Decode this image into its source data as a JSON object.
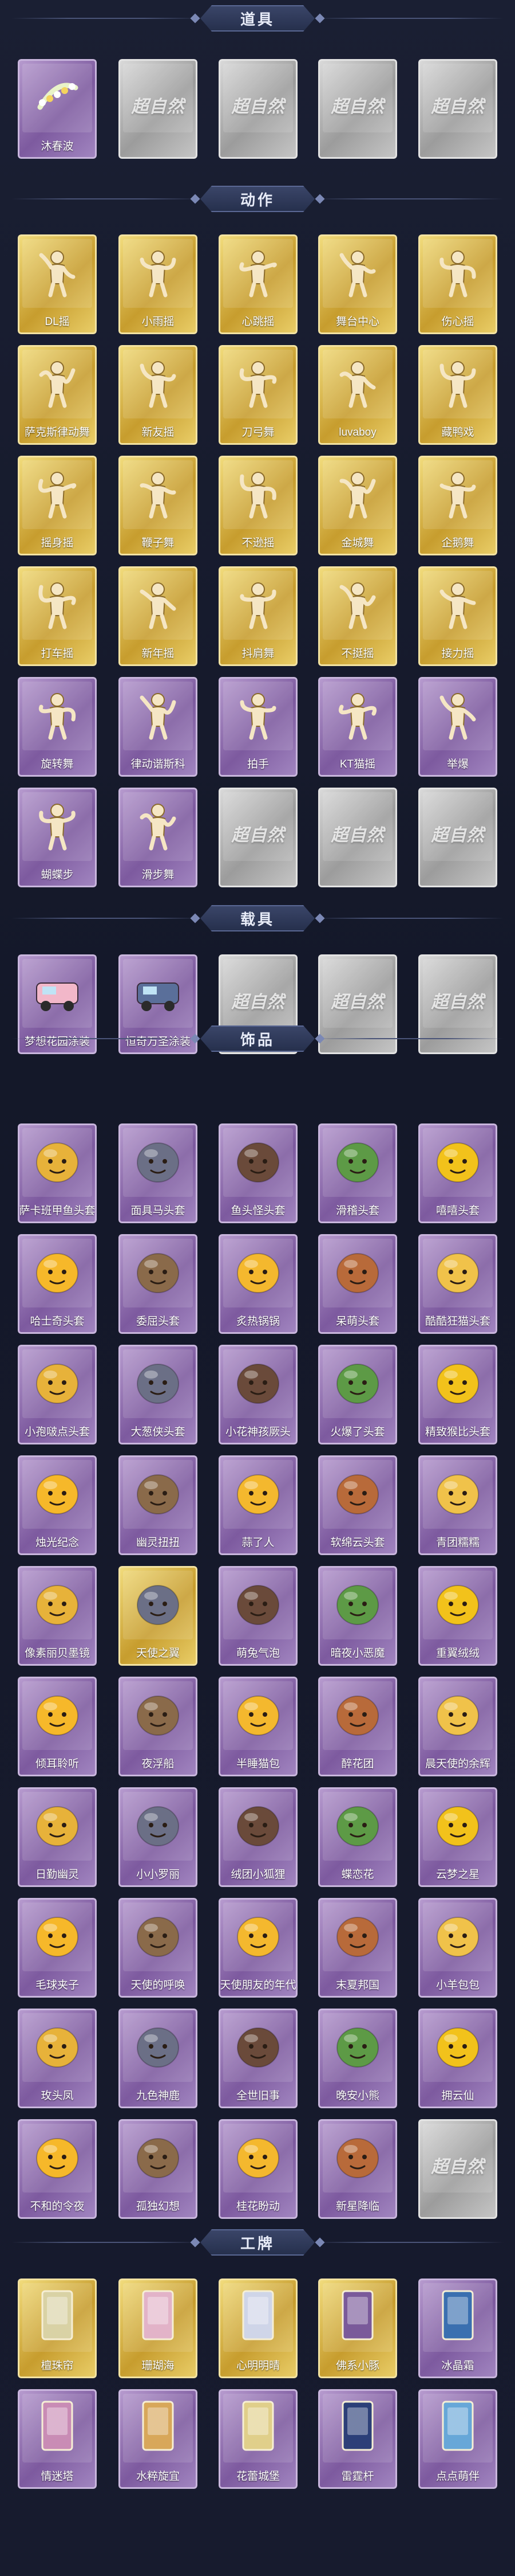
{
  "colors": {
    "background": "#161a2b",
    "gold": "#d4ab3a",
    "purple": "#8f6bb1",
    "locked": "#b3b3b3"
  },
  "locked_logo": "超自然",
  "sections": [
    {
      "title": "道具",
      "icon": "prop",
      "items": [
        {
          "name": "沐春波",
          "rarity": "purple"
        },
        {
          "name": "",
          "rarity": "locked"
        },
        {
          "name": "",
          "rarity": "locked"
        },
        {
          "name": "",
          "rarity": "locked"
        },
        {
          "name": "",
          "rarity": "locked"
        }
      ]
    },
    {
      "title": "动作",
      "icon": "pose",
      "items": [
        {
          "name": "DL摇",
          "rarity": "gold"
        },
        {
          "name": "小雨摇",
          "rarity": "gold"
        },
        {
          "name": "心跳摇",
          "rarity": "gold"
        },
        {
          "name": "舞台中心",
          "rarity": "gold"
        },
        {
          "name": "伤心摇",
          "rarity": "gold"
        },
        {
          "name": "萨克斯律动舞",
          "rarity": "gold"
        },
        {
          "name": "新友摇",
          "rarity": "gold"
        },
        {
          "name": "刀弓舞",
          "rarity": "gold"
        },
        {
          "name": "luvaboy",
          "rarity": "gold"
        },
        {
          "name": "藏鸭戏",
          "rarity": "gold"
        },
        {
          "name": "摇身摇",
          "rarity": "gold"
        },
        {
          "name": "鞭子舞",
          "rarity": "gold"
        },
        {
          "name": "不逊摇",
          "rarity": "gold"
        },
        {
          "name": "金城舞",
          "rarity": "gold"
        },
        {
          "name": "企鹅舞",
          "rarity": "gold"
        },
        {
          "name": "打车摇",
          "rarity": "gold"
        },
        {
          "name": "新年摇",
          "rarity": "gold"
        },
        {
          "name": "抖肩舞",
          "rarity": "gold"
        },
        {
          "name": "不挺摇",
          "rarity": "gold"
        },
        {
          "name": "接力摇",
          "rarity": "gold"
        },
        {
          "name": "旋转舞",
          "rarity": "purple"
        },
        {
          "name": "律动谐斯科",
          "rarity": "purple"
        },
        {
          "name": "拍手",
          "rarity": "purple"
        },
        {
          "name": "KT猫摇",
          "rarity": "purple"
        },
        {
          "name": "举爆",
          "rarity": "purple"
        },
        {
          "name": "蝴蝶步",
          "rarity": "purple"
        },
        {
          "name": "滑步舞",
          "rarity": "purple"
        },
        {
          "name": "",
          "rarity": "locked"
        },
        {
          "name": "",
          "rarity": "locked"
        },
        {
          "name": "",
          "rarity": "locked"
        }
      ]
    },
    {
      "title": "载具",
      "icon": "vehicle",
      "items": [
        {
          "name": "梦想花园涂装",
          "rarity": "purple"
        },
        {
          "name": "恒奇万圣涂装",
          "rarity": "purple"
        },
        {
          "name": "",
          "rarity": "locked"
        },
        {
          "name": "",
          "rarity": "locked"
        },
        {
          "name": "",
          "rarity": "locked"
        }
      ]
    },
    {
      "title": "饰品",
      "icon": "head",
      "items": [
        {
          "name": "萨卡班甲鱼头套",
          "rarity": "purple"
        },
        {
          "name": "面具马头套",
          "rarity": "purple"
        },
        {
          "name": "鱼头怪头套",
          "rarity": "purple"
        },
        {
          "name": "滑稽头套",
          "rarity": "purple"
        },
        {
          "name": "嘻嘻头套",
          "rarity": "purple"
        },
        {
          "name": "哈士奇头套",
          "rarity": "purple"
        },
        {
          "name": "委屈头套",
          "rarity": "purple"
        },
        {
          "name": "炙热锅锅",
          "rarity": "purple"
        },
        {
          "name": "呆萌头套",
          "rarity": "purple"
        },
        {
          "name": "酷酷狂猫头套",
          "rarity": "purple"
        },
        {
          "name": "小孢啵点头套",
          "rarity": "purple"
        },
        {
          "name": "大葱侠头套",
          "rarity": "purple"
        },
        {
          "name": "小花神孩厥头",
          "rarity": "purple"
        },
        {
          "name": "火爆了头套",
          "rarity": "purple"
        },
        {
          "name": "精致猴比头套",
          "rarity": "purple"
        },
        {
          "name": "烛光纪念",
          "rarity": "purple"
        },
        {
          "name": "幽灵扭扭",
          "rarity": "purple"
        },
        {
          "name": "蒜了人",
          "rarity": "purple"
        },
        {
          "name": "软绵云头套",
          "rarity": "purple"
        },
        {
          "name": "青团糯糯",
          "rarity": "purple"
        },
        {
          "name": "像素丽贝墨镜",
          "rarity": "purple"
        },
        {
          "name": "天使之翼",
          "rarity": "gold"
        },
        {
          "name": "萌兔气泡",
          "rarity": "purple"
        },
        {
          "name": "暗夜小恶魔",
          "rarity": "purple"
        },
        {
          "name": "重翼绒绒",
          "rarity": "purple"
        },
        {
          "name": "倾耳聆听",
          "rarity": "purple"
        },
        {
          "name": "夜浮船",
          "rarity": "purple"
        },
        {
          "name": "半睡猫包",
          "rarity": "purple"
        },
        {
          "name": "醉花团",
          "rarity": "purple"
        },
        {
          "name": "晨天使的余辉",
          "rarity": "purple"
        },
        {
          "name": "日勤幽灵",
          "rarity": "purple"
        },
        {
          "name": "小小罗丽",
          "rarity": "purple"
        },
        {
          "name": "绒团小狐狸",
          "rarity": "purple"
        },
        {
          "name": "蝶恋花",
          "rarity": "purple"
        },
        {
          "name": "云梦之星",
          "rarity": "purple"
        },
        {
          "name": "毛球夹子",
          "rarity": "purple"
        },
        {
          "name": "天使的呼唤",
          "rarity": "purple"
        },
        {
          "name": "天使朋友的年代",
          "rarity": "purple"
        },
        {
          "name": "末夏邦国",
          "rarity": "purple"
        },
        {
          "name": "小羊包包",
          "rarity": "purple"
        },
        {
          "name": "玫头凤",
          "rarity": "purple"
        },
        {
          "name": "九色神鹿",
          "rarity": "purple"
        },
        {
          "name": "全世旧事",
          "rarity": "purple"
        },
        {
          "name": "晚安小熊",
          "rarity": "purple"
        },
        {
          "name": "拥云仙",
          "rarity": "purple"
        },
        {
          "name": "不和的令夜",
          "rarity": "purple"
        },
        {
          "name": "孤独幻想",
          "rarity": "purple"
        },
        {
          "name": "桂花盼动",
          "rarity": "purple"
        },
        {
          "name": "新星降临",
          "rarity": "purple"
        },
        {
          "name": "",
          "rarity": "locked"
        }
      ]
    },
    {
      "title": "工牌",
      "icon": "card",
      "items": [
        {
          "name": "檀珠帘",
          "rarity": "gold"
        },
        {
          "name": "珊瑚海",
          "rarity": "gold"
        },
        {
          "name": "心明明晴",
          "rarity": "gold"
        },
        {
          "name": "佛系小豚",
          "rarity": "gold"
        },
        {
          "name": "冰晶霜",
          "rarity": "purple"
        },
        {
          "name": "情迷塔",
          "rarity": "purple"
        },
        {
          "name": "水粹旋宜",
          "rarity": "purple"
        },
        {
          "name": "花蕾城堡",
          "rarity": "purple"
        },
        {
          "name": "雷霆杆",
          "rarity": "purple"
        },
        {
          "name": "点点萌伴",
          "rarity": "purple"
        }
      ]
    }
  ]
}
